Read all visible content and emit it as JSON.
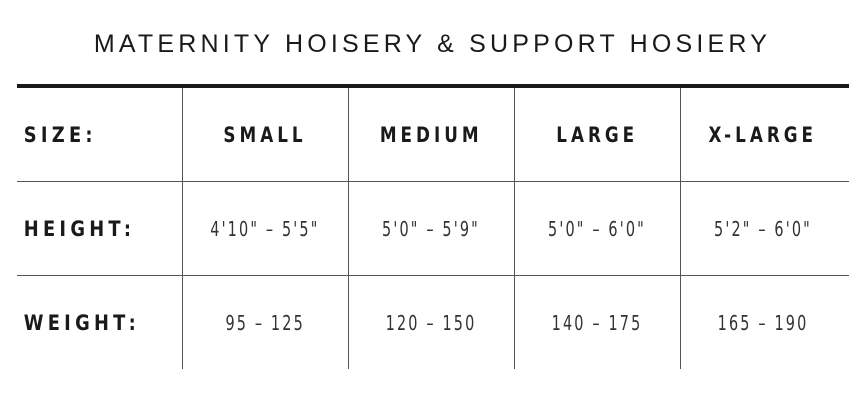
{
  "title": "MATERNITY HOISERY & SUPPORT HOSIERY",
  "table": {
    "header": {
      "label": "SIZE:",
      "columns": [
        "SMALL",
        "MEDIUM",
        "LARGE",
        "X-LARGE"
      ]
    },
    "rows": [
      {
        "label": "HEIGHT:",
        "values": [
          "4'10\" – 5'5\"",
          "5'0\" – 5'9\"",
          "5'0\" – 6'0\"",
          "5'2\" – 6'0\""
        ]
      },
      {
        "label": "WEIGHT:",
        "values": [
          "95 – 125",
          "120 – 150",
          "140 – 175",
          "165 – 190"
        ]
      }
    ]
  }
}
